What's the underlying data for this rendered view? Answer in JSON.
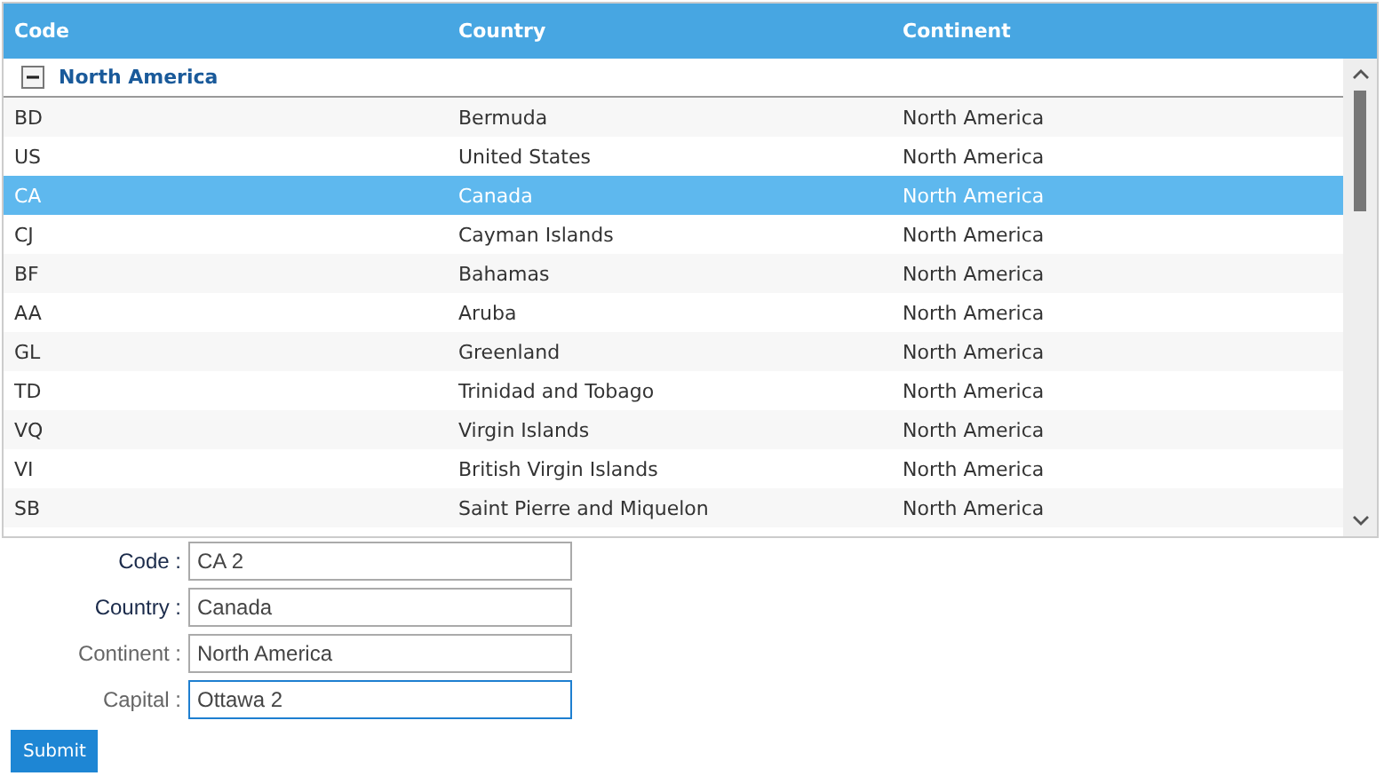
{
  "table": {
    "columns": [
      "Code",
      "Country",
      "Continent"
    ],
    "group": {
      "label": "North America",
      "expanded": true
    },
    "rows": [
      {
        "code": "BD",
        "country": "Bermuda",
        "continent": "North America",
        "selected": false
      },
      {
        "code": "US",
        "country": "United States",
        "continent": "North America",
        "selected": false
      },
      {
        "code": "CA",
        "country": "Canada",
        "continent": "North America",
        "selected": true
      },
      {
        "code": "CJ",
        "country": "Cayman Islands",
        "continent": "North America",
        "selected": false
      },
      {
        "code": "BF",
        "country": "Bahamas",
        "continent": "North America",
        "selected": false
      },
      {
        "code": "AA",
        "country": "Aruba",
        "continent": "North America",
        "selected": false
      },
      {
        "code": "GL",
        "country": "Greenland",
        "continent": "North America",
        "selected": false
      },
      {
        "code": "TD",
        "country": "Trinidad and Tobago",
        "continent": "North America",
        "selected": false
      },
      {
        "code": "VQ",
        "country": "Virgin Islands",
        "continent": "North America",
        "selected": false
      },
      {
        "code": "VI",
        "country": "British Virgin Islands",
        "continent": "North America",
        "selected": false
      },
      {
        "code": "SB",
        "country": "Saint Pierre and Miquelon",
        "continent": "North America",
        "selected": false
      }
    ]
  },
  "form": {
    "fields": [
      {
        "label": "Code :",
        "value": "CA 2",
        "required": true,
        "focused": false
      },
      {
        "label": "Country :",
        "value": "Canada",
        "required": true,
        "focused": false
      },
      {
        "label": "Continent :",
        "value": "North America",
        "required": false,
        "focused": false
      },
      {
        "label": "Capital :",
        "value": "Ottawa 2",
        "required": false,
        "focused": true
      }
    ],
    "submit": "Submit"
  }
}
